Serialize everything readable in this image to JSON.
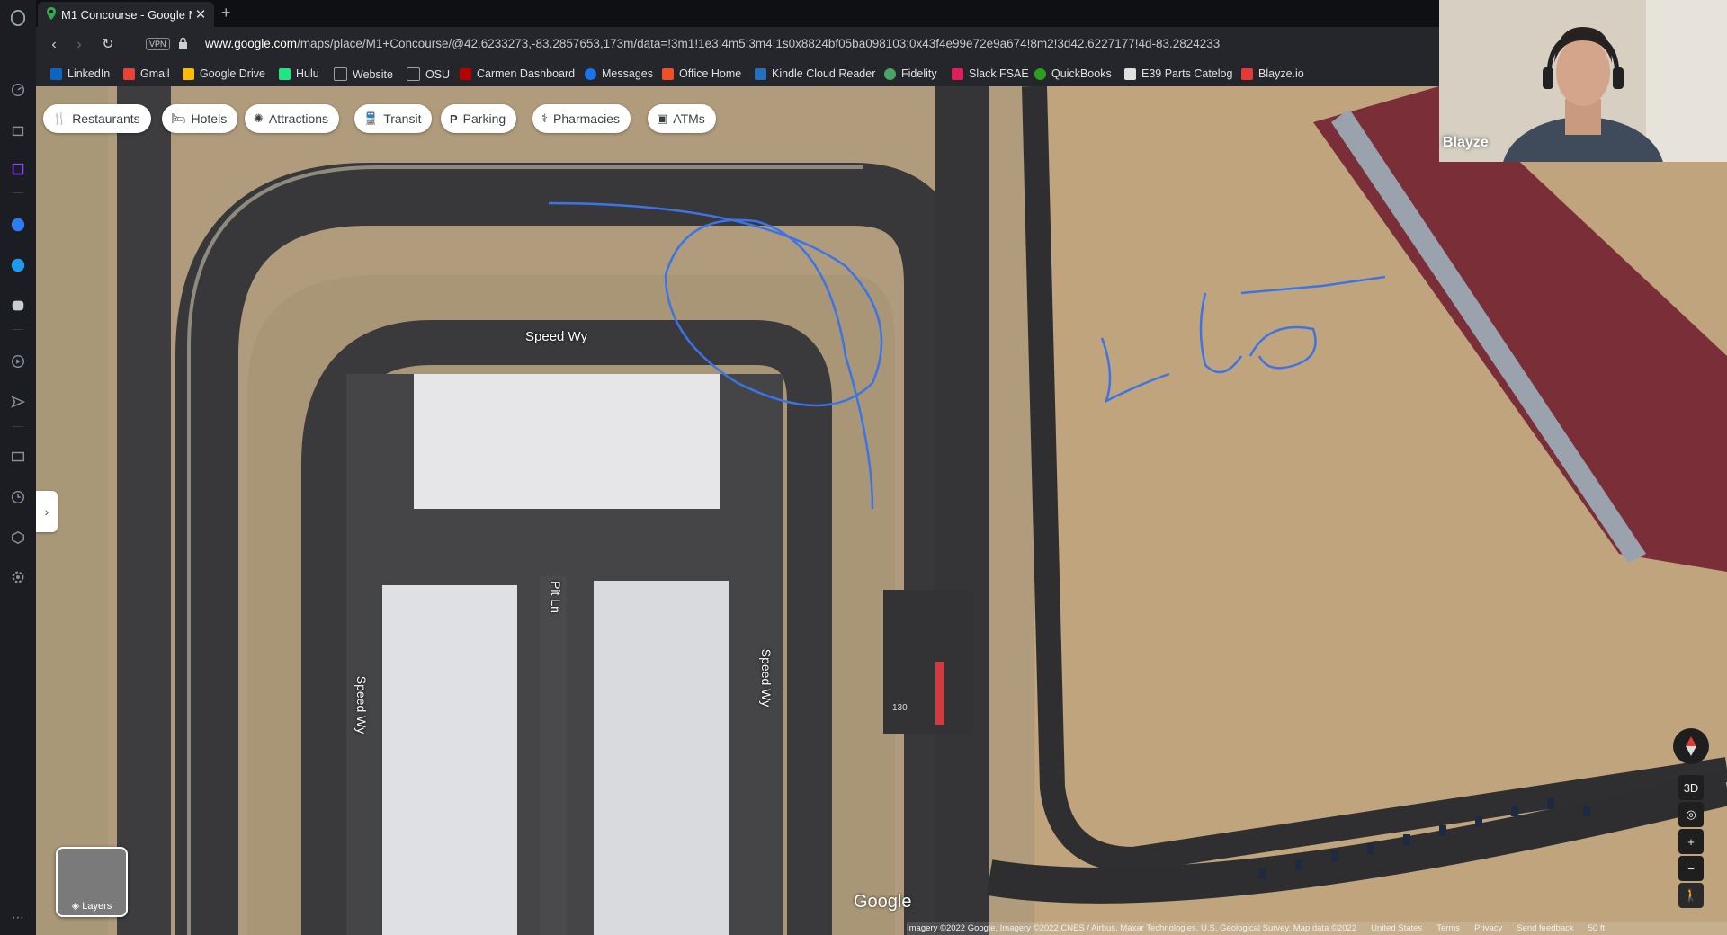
{
  "browser": {
    "tab_title": "M1 Concourse - Google M",
    "url_host": "www.google.com",
    "url_rest": "/maps/place/M1+Concourse/@42.6233273,-83.2857653,173m/data=!3m1!1e3!4m5!3m4!1s0x8824bf05ba098103:0x43f4e99e72e9a674!8m2!3d42.6227177!4d-83.2824233",
    "vpn_label": "VPN"
  },
  "bookmarks": [
    {
      "label": "LinkedIn",
      "color": "#0a66c2"
    },
    {
      "label": "Gmail",
      "color": "#ea4335"
    },
    {
      "label": "Google Drive",
      "color": "#fbbc04"
    },
    {
      "label": "Hulu",
      "color": "#1ce783"
    },
    {
      "label": "Website",
      "color": "#9aa0a6"
    },
    {
      "label": "OSU",
      "color": "#9aa0a6"
    },
    {
      "label": "Carmen Dashboard",
      "color": "#bb0000"
    },
    {
      "label": "Messages",
      "color": "#1a73e8"
    },
    {
      "label": "Office Home",
      "color": "#f25022"
    },
    {
      "label": "Kindle Cloud Reader",
      "color": "#2a6ebb"
    },
    {
      "label": "Fidelity",
      "color": "#4aa564"
    },
    {
      "label": "Slack FSAE",
      "color": "#e01e5a"
    },
    {
      "label": "QuickBooks",
      "color": "#2ca01c"
    },
    {
      "label": "E39 Parts Catelog",
      "color": "#e0e0e0"
    },
    {
      "label": "Blayze.io",
      "color": "#e53935"
    }
  ],
  "map": {
    "chips": [
      {
        "label": "Restaurants",
        "icon": "restaurant-icon"
      },
      {
        "label": "Hotels",
        "icon": "hotel-icon"
      },
      {
        "label": "Attractions",
        "icon": "attractions-icon"
      },
      {
        "label": "Transit",
        "icon": "transit-icon"
      },
      {
        "label": "Parking",
        "icon": "parking-icon"
      },
      {
        "label": "Pharmacies",
        "icon": "pharmacy-icon"
      },
      {
        "label": "ATMs",
        "icon": "atm-icon"
      }
    ],
    "road_labels": {
      "speed_wy_top": "Speed Wy",
      "speed_wy_left": "Speed Wy",
      "speed_wy_right": "Speed Wy",
      "pit_ln": "Pit Ln",
      "marker_130": "130"
    },
    "layers_label": "Layers",
    "logo": "Google",
    "attribution": [
      "Imagery ©2022 Google, Imagery ©2022 CNES / Airbus, Maxar Technologies, U.S. Geological Survey, Map data ©2022",
      "United States",
      "Terms",
      "Privacy",
      "Send feedback",
      "50 ft"
    ],
    "ctrl_3d": "3D"
  },
  "webcam": {
    "name": "Blayze"
  }
}
